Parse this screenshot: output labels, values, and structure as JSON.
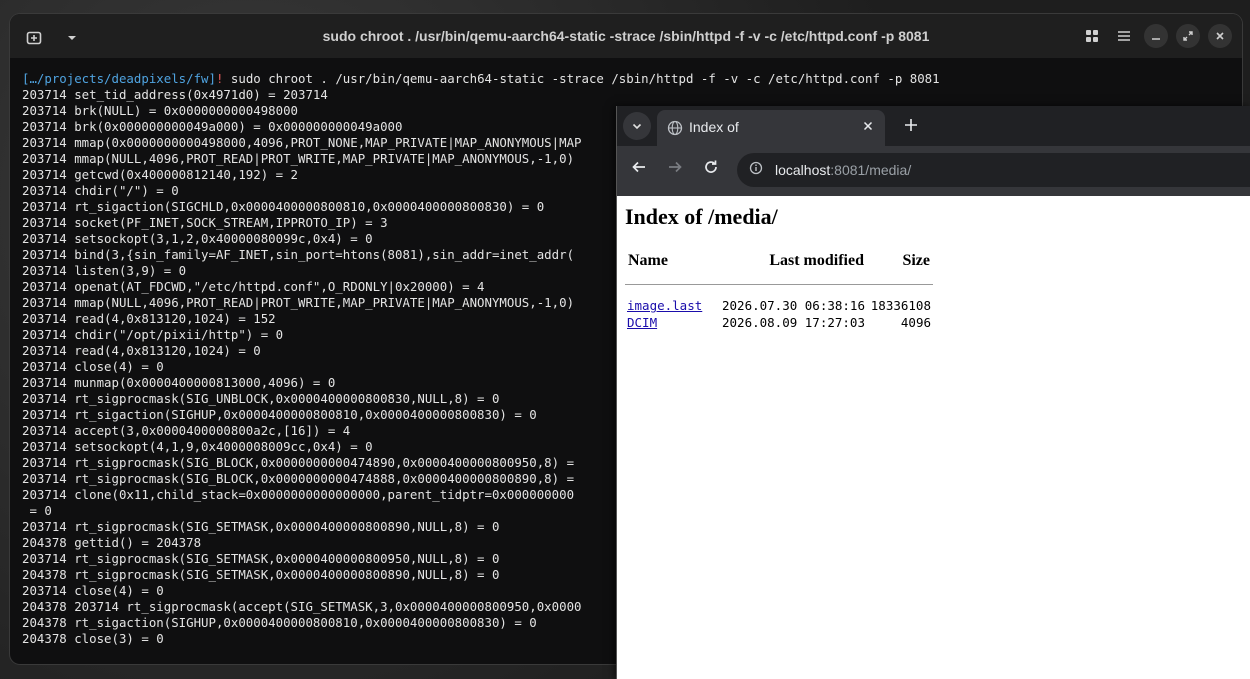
{
  "terminal": {
    "title": "sudo chroot . /usr/bin/qemu-aarch64-static -strace /sbin/httpd -f -v -c /etc/httpd.conf -p 8081",
    "prompt_path": "[…/projects/deadpixels/fw]",
    "prompt_bang": "!",
    "command": " sudo chroot . /usr/bin/qemu-aarch64-static -strace /sbin/httpd -f -v -c /etc/httpd.conf -p 8081",
    "lines": [
      "203714 set_tid_address(0x4971d0) = 203714",
      "203714 brk(NULL) = 0x0000000000498000",
      "203714 brk(0x000000000049a000) = 0x000000000049a000",
      "203714 mmap(0x0000000000498000,4096,PROT_NONE,MAP_PRIVATE|MAP_ANONYMOUS|MAP",
      "203714 mmap(NULL,4096,PROT_READ|PROT_WRITE,MAP_PRIVATE|MAP_ANONYMOUS,-1,0)",
      "203714 getcwd(0x400000812140,192) = 2",
      "203714 chdir(\"/\") = 0",
      "203714 rt_sigaction(SIGCHLD,0x0000400000800810,0x0000400000800830) = 0",
      "203714 socket(PF_INET,SOCK_STREAM,IPPROTO_IP) = 3",
      "203714 setsockopt(3,1,2,0x40000080099c,0x4) = 0",
      "203714 bind(3,{sin_family=AF_INET,sin_port=htons(8081),sin_addr=inet_addr(",
      "203714 listen(3,9) = 0",
      "203714 openat(AT_FDCWD,\"/etc/httpd.conf\",O_RDONLY|0x20000) = 4",
      "203714 mmap(NULL,4096,PROT_READ|PROT_WRITE,MAP_PRIVATE|MAP_ANONYMOUS,-1,0)",
      "203714 read(4,0x813120,1024) = 152",
      "203714 chdir(\"/opt/pixii/http\") = 0",
      "203714 read(4,0x813120,1024) = 0",
      "203714 close(4) = 0",
      "203714 munmap(0x0000400000813000,4096) = 0",
      "203714 rt_sigprocmask(SIG_UNBLOCK,0x0000400000800830,NULL,8) = 0",
      "203714 rt_sigaction(SIGHUP,0x0000400000800810,0x0000400000800830) = 0",
      "203714 accept(3,0x0000400000800a2c,[16]) = 4",
      "203714 setsockopt(4,1,9,0x4000008009cc,0x4) = 0",
      "203714 rt_sigprocmask(SIG_BLOCK,0x0000000000474890,0x0000400000800950,8) =",
      "203714 rt_sigprocmask(SIG_BLOCK,0x0000000000474888,0x0000400000800890,8) =",
      "203714 clone(0x11,child_stack=0x0000000000000000,parent_tidptr=0x000000000",
      " = 0",
      "203714 rt_sigprocmask(SIG_SETMASK,0x0000400000800890,NULL,8) = 0",
      "204378 gettid() = 204378",
      "203714 rt_sigprocmask(SIG_SETMASK,0x0000400000800950,NULL,8) = 0",
      "204378 rt_sigprocmask(SIG_SETMASK,0x0000400000800890,NULL,8) = 0",
      "203714 close(4) = 0",
      "204378 203714 rt_sigprocmask(accept(SIG_SETMASK,3,0x0000400000800950,0x0000",
      "204378 rt_sigaction(SIGHUP,0x0000400000800810,0x0000400000800830) = 0",
      "204378 close(3) = 0"
    ],
    "colors": {
      "prompt_path": "#4fa3e0",
      "prompt_bang": "#e05a5a",
      "text": "#e4e4e4"
    }
  },
  "browser": {
    "tab_title": "Index of",
    "url_host": "localhost",
    "url_rest": ":8081/media/",
    "page": {
      "heading": "Index of /media/",
      "columns": {
        "name": "Name",
        "modified": "Last modified",
        "size": "Size"
      },
      "rows": [
        {
          "name": "image.last",
          "modified": "2026.07.30 06:38:16",
          "size": "18336108"
        },
        {
          "name": "DCIM",
          "modified": "2026.08.09 17:27:03",
          "size": "4096"
        }
      ]
    }
  }
}
